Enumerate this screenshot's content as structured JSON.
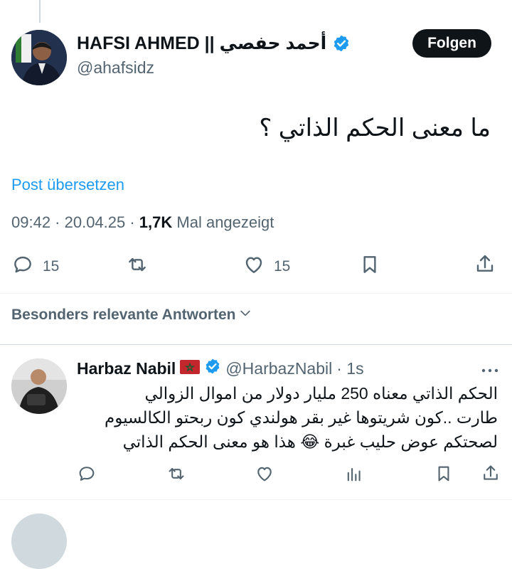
{
  "author": {
    "name": "HAFSI AHMED || أحمد حفصي",
    "handle": "@ahafsidz",
    "follow_label": "Folgen"
  },
  "tweet": {
    "text": "ما معنى الحكم الذاتي ؟",
    "translate_label": "Post übersetzen",
    "time": "09:42 · 20.04.25 · ",
    "views_count": "1,7K",
    "views_label": " Mal angezeigt"
  },
  "actions": {
    "replies": "15",
    "likes": "15"
  },
  "sort_label": "Besonders relevante Antworten",
  "reply": {
    "name": "Harbaz Nabil",
    "handle": "@HarbazNabil",
    "time": "· 1s",
    "lines": [
      "الحكم الذاتي معناه 250 مليار دولار من اموال الزوالي",
      "طارت ..كون شريتوها غير بقر هولندي كون ربحتو الكالسيوم",
      "لصحتكم عوض حليب غبرة 😂 هذا هو معنى الحكم الذاتي"
    ]
  },
  "colors": {
    "accent": "#1d9bf0",
    "secondary_text": "#536471",
    "primary_text": "#0f1419"
  },
  "icons": [
    "reply-icon",
    "retweet-icon",
    "like-icon",
    "bookmark-icon",
    "share-icon",
    "views-icon",
    "verified-badge-icon",
    "chevron-down-icon",
    "more-icon"
  ]
}
